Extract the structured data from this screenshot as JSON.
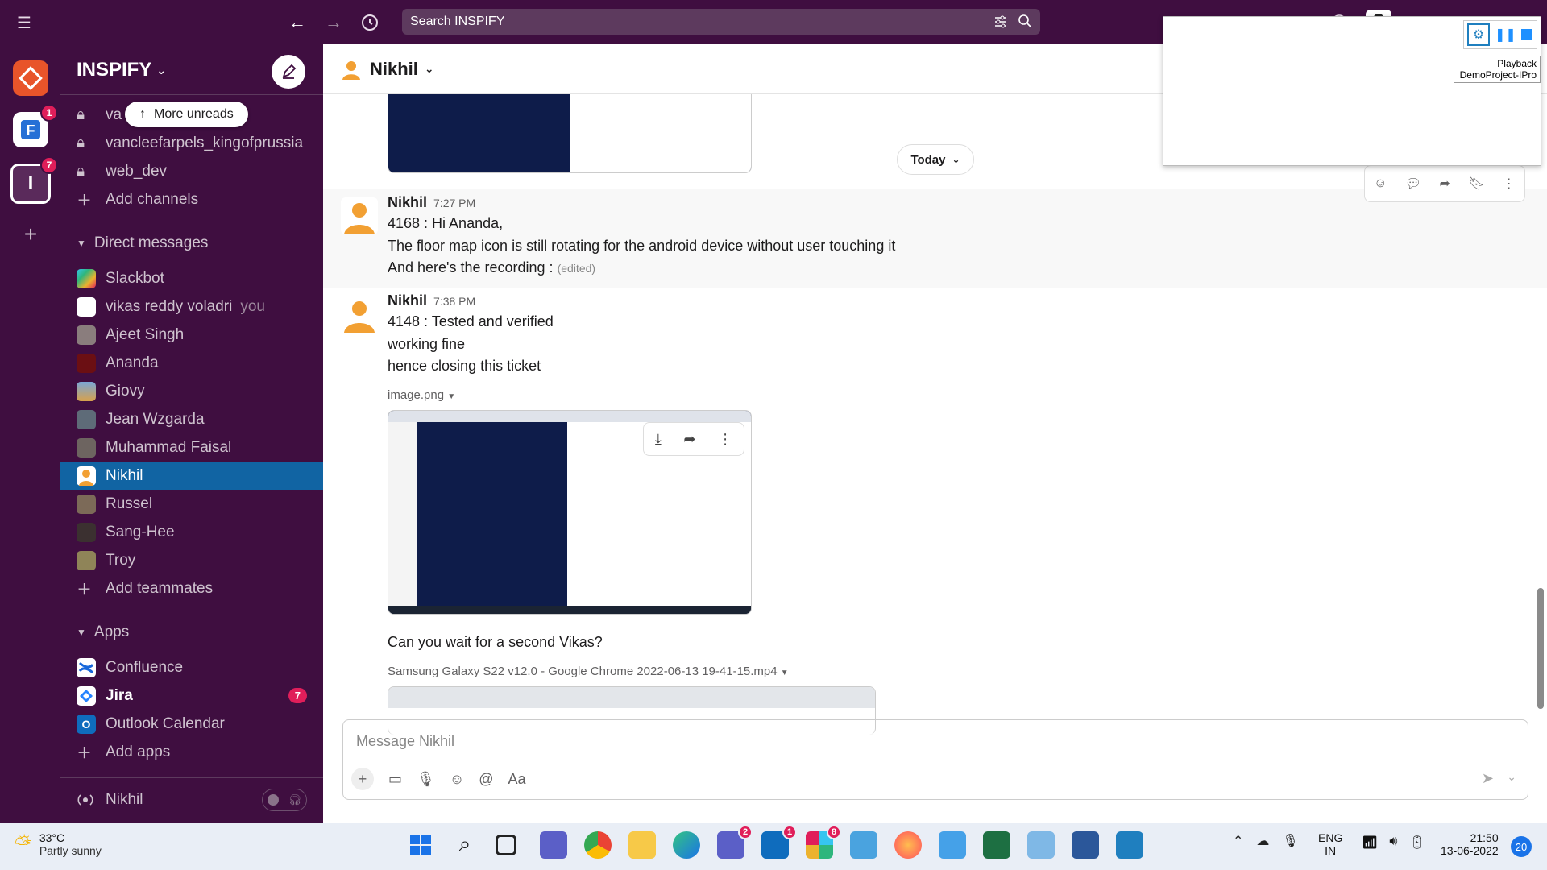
{
  "topbar": {
    "search_placeholder": "Search INSPIFY"
  },
  "rail": {
    "ws1_badge": "1",
    "ws2_letter": "I",
    "ws2_badge": "7"
  },
  "sidebar": {
    "workspace": "INSPIFY",
    "more_unreads": "More unreads",
    "channels": [
      "va",
      "vancleefarpels_kingofprussia",
      "web_dev"
    ],
    "add_channels": "Add channels",
    "dm_title": "Direct messages",
    "dms": [
      {
        "name": "Slackbot"
      },
      {
        "name": "vikas reddy voladri",
        "suffix": "you"
      },
      {
        "name": "Ajeet Singh"
      },
      {
        "name": "Ananda"
      },
      {
        "name": "Giovy"
      },
      {
        "name": "Jean Wzgarda"
      },
      {
        "name": "Muhammad Faisal"
      },
      {
        "name": "Nikhil"
      },
      {
        "name": "Russel"
      },
      {
        "name": "Sang-Hee"
      },
      {
        "name": "Troy"
      }
    ],
    "add_teammates": "Add teammates",
    "apps_title": "Apps",
    "apps": [
      {
        "name": "Confluence"
      },
      {
        "name": "Jira",
        "badge": "7"
      },
      {
        "name": "Outlook Calendar"
      }
    ],
    "add_apps": "Add apps",
    "footer_name": "Nikhil"
  },
  "channel": {
    "title": "Nikhil",
    "today": "Today"
  },
  "messages": [
    {
      "author": "Nikhil",
      "time": "7:27 PM",
      "lines": [
        "4168 : Hi Ananda,",
        "The floor map icon is still rotating for the android device without user touching it",
        "And here's the recording :"
      ],
      "edited": "(edited)"
    },
    {
      "author": "Nikhil",
      "time": "7:38 PM",
      "lines": [
        "4148 : Tested and verified",
        "working fine",
        "hence closing this ticket"
      ],
      "file": "image.png",
      "after": "Can you wait for a second Vikas?",
      "video": "Samsung Galaxy S22 v12.0 - Google Chrome 2022-06-13 19-41-15.mp4"
    }
  ],
  "composer": {
    "placeholder": "Message Nikhil"
  },
  "float": {
    "line1": "Playback",
    "line2": "DemoProject-IPro"
  },
  "taskbar": {
    "temp": "33°C",
    "weather": "Partly sunny",
    "lang1": "ENG",
    "lang2": "IN",
    "time": "21:50",
    "date": "13-06-2022",
    "notif": "20",
    "teams_badge": "2",
    "outlook_badge": "1",
    "slack_badge": "8"
  }
}
